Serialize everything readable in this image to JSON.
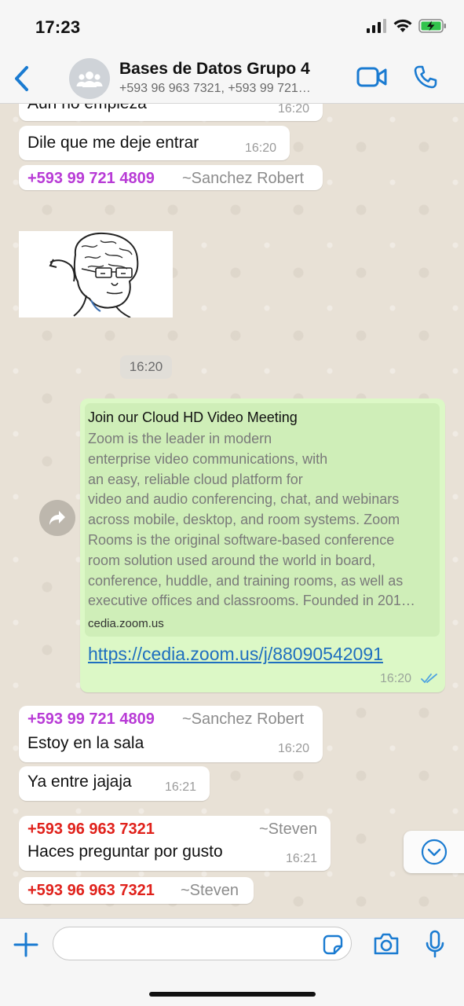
{
  "status_bar": {
    "time": "17:23"
  },
  "header": {
    "title": "Bases de Datos Grupo 4",
    "subtitle": "+593 96 963 7321, +593 99 721…"
  },
  "messages": {
    "m0": {
      "text": "Aun no empieza",
      "time": "16:20"
    },
    "m1": {
      "text": "Dile que me deje entrar",
      "time": "16:20"
    },
    "m2": {
      "phone": "+593 99 721 4809",
      "name": "~Sanchez Robert"
    },
    "image_time": "16:20",
    "link": {
      "preview_title": "Join our Cloud HD Video Meeting",
      "preview_description": "Zoom is the leader in modern\nenterprise video communications, with\nan easy, reliable cloud platform for\nvideo and audio conferencing, chat, and webinars\nacross mobile, desktop, and room systems. Zoom\nRooms is the original software-based conference\nroom solution used around the world in board,\nconference, huddle, and training rooms, as well as\nexecutive offices and classrooms. Founded in 201…",
      "preview_domain": "cedia.zoom.us",
      "url": "https://cedia.zoom.us/j/88090542091",
      "time": "16:20"
    },
    "m3": {
      "phone": "+593 99 721 4809",
      "name": "~Sanchez Robert",
      "text": "Estoy en la sala",
      "time": "16:20"
    },
    "m4": {
      "text": "Ya entre jajaja",
      "time": "16:21"
    },
    "m5": {
      "phone": "+593 96 963 7321",
      "name": "~Steven",
      "text": "Haces preguntar por gusto",
      "time": "16:21"
    },
    "m6": {
      "phone": "+593 96 963 7321",
      "name": "~Steven"
    }
  },
  "input": {
    "placeholder": ""
  },
  "colors": {
    "accent": "#1a7bd1",
    "sender_purple": "#b83bd6",
    "sender_red": "#e0211b",
    "outgoing_bubble": "#dcf8c6",
    "incoming_bubble": "#ffffff",
    "read_ticks": "#4fa3e0"
  },
  "icons": [
    "back-chevron-icon",
    "group-icon",
    "video-call-icon",
    "phone-icon",
    "forward-icon",
    "double-check-icon",
    "chevron-down-icon",
    "plus-icon",
    "sticker-icon",
    "camera-icon",
    "mic-icon"
  ]
}
